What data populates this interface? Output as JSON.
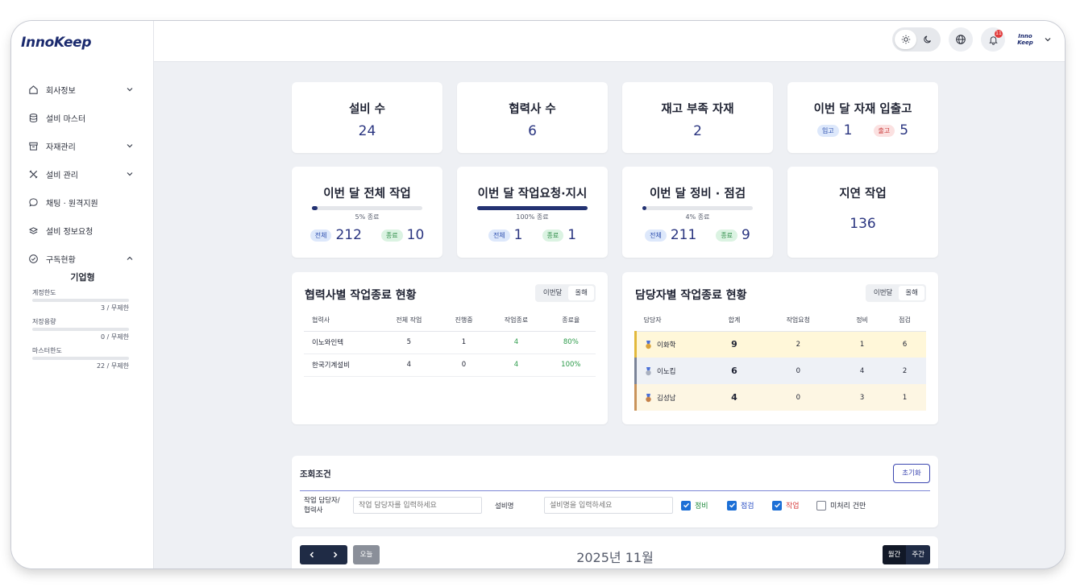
{
  "app": {
    "logo": "InnoKeep"
  },
  "sidebar": {
    "items": [
      {
        "label": "회사정보",
        "icon": "home-icon",
        "chevron": "down"
      },
      {
        "label": "설비 마스터",
        "icon": "database-icon",
        "chevron": ""
      },
      {
        "label": "자재관리",
        "icon": "box-icon",
        "chevron": "down"
      },
      {
        "label": "설비 관리",
        "icon": "tools-icon",
        "chevron": "down"
      },
      {
        "label": "채팅 · 원격지원",
        "icon": "chat-icon",
        "chevron": ""
      },
      {
        "label": "설비 정보요청",
        "icon": "layers-icon",
        "chevron": ""
      },
      {
        "label": "구독현황",
        "icon": "check-circle-icon",
        "chevron": "up"
      }
    ],
    "subscription": {
      "plan": "기업형",
      "usage": [
        {
          "label": "계정한도",
          "value": "3 / 무제한",
          "fraction": 0
        },
        {
          "label": "저장용량",
          "value": "0 / 무제한",
          "fraction": 0
        },
        {
          "label": "마스터한도",
          "value": "22 / 무제한",
          "fraction": 0
        }
      ]
    }
  },
  "header": {
    "notification_count": "11",
    "avatar_text_1": "Inno",
    "avatar_text_2": "Keep"
  },
  "stats": {
    "equipment": {
      "title": "설비 수",
      "value": "24"
    },
    "partners": {
      "title": "협력사 수",
      "value": "6"
    },
    "low_stock": {
      "title": "재고 부족 자재",
      "value": "2"
    },
    "monthly_io": {
      "title": "이번 달 자재 입출고",
      "in_label": "입고",
      "in_value": "1",
      "out_label": "출고",
      "out_value": "5"
    }
  },
  "work_cards": [
    {
      "title": "이번 달 전체 작업",
      "progress": 0.05,
      "progress_label": "5% 종료",
      "total_label": "전체",
      "total": "212",
      "done_label": "종료",
      "done": "10"
    },
    {
      "title": "이번 달 작업요청·지시",
      "progress": 1.0,
      "progress_label": "100% 종료",
      "total_label": "전체",
      "total": "1",
      "done_label": "종료",
      "done": "1"
    },
    {
      "title": "이번 달 정비 · 점검",
      "progress": 0.04,
      "progress_label": "4% 종료",
      "total_label": "전체",
      "total": "211",
      "done_label": "종료",
      "done": "9"
    }
  ],
  "delayed": {
    "title": "지연 작업",
    "value": "136"
  },
  "partner_table": {
    "title": "협력사별 작업종료 현황",
    "toggle": [
      "이번달",
      "올해"
    ],
    "columns": [
      "협력사",
      "전체 작업",
      "진행중",
      "작업종료",
      "종료율"
    ],
    "rows": [
      [
        "이노와인텍",
        "5",
        "1",
        "4",
        "80%"
      ],
      [
        "한국기계설비",
        "4",
        "0",
        "4",
        "100%"
      ]
    ]
  },
  "assignee_table": {
    "title": "담당자별 작업종료 현황",
    "toggle": [
      "이번달",
      "올해"
    ],
    "columns": [
      "담당자",
      "합계",
      "작업요청",
      "정비",
      "점검"
    ],
    "rows": [
      [
        "이화학",
        "9",
        "2",
        "1",
        "6"
      ],
      [
        "이노킵",
        "6",
        "0",
        "4",
        "2"
      ],
      [
        "김성남",
        "4",
        "0",
        "3",
        "1"
      ]
    ]
  },
  "filter": {
    "title": "조회조건",
    "reset": "초기화",
    "assignee_label_1": "작업 담당자/",
    "assignee_label_2": "협력사",
    "assignee_placeholder": "작업 담당자를 입력하세요",
    "equipment_label": "설비명",
    "equipment_placeholder": "설비명을 입력하세요",
    "checks": [
      {
        "label": "정비",
        "checked": true,
        "color": "#1f8a3c"
      },
      {
        "label": "점검",
        "checked": true,
        "color": "#2a4fc4"
      },
      {
        "label": "작업",
        "checked": true,
        "color": "#d63b3b"
      },
      {
        "label": "미처리 건만",
        "checked": false,
        "color": "#2a2e3a"
      }
    ]
  },
  "calendar": {
    "today": "오늘",
    "month": "2025년 11월",
    "views": [
      "월간",
      "주간"
    ]
  }
}
